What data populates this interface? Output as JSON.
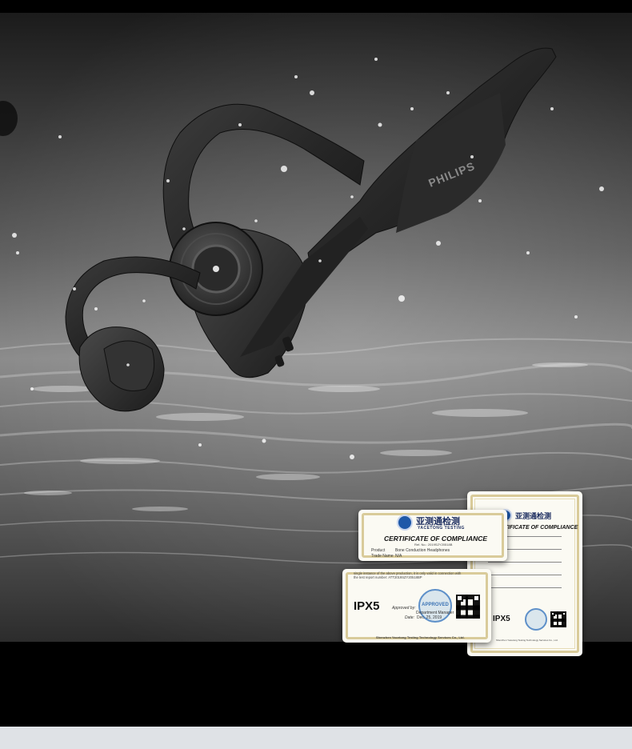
{
  "headphone": {
    "brand": "PHILIPS"
  },
  "certificates": {
    "issuer_cn": "亚测通检测",
    "issuer_en": "YACETONG TESTING",
    "front_top": {
      "title": "CERTIFICATE OF COMPLIANCE",
      "ref": "Ref. No.: 2019SZY20518B",
      "product_label": "Product",
      "product_value": "Bone Conduction Headphones",
      "trade_label": "Trade Name",
      "trade_value": "N/A"
    },
    "front_bottom": {
      "rating": "IPX5",
      "text_line1": "single instance of the above production, it is only valid in connection with",
      "text_line2": "the test report number: ATT2019SZY20518BP",
      "approved_label": "Approved by:",
      "dept_label": "Department Manager",
      "date_label": "Date:",
      "date_value": "Dec. 25, 2019",
      "stamp_text": "APPROVED",
      "company": "Shenzhen Yacetong Testing Technology Services Co., Ltd."
    },
    "back": {
      "title": "CERTIFICATE OF COMPLIANCE",
      "rating": "IPX5",
      "company": "Shenzhen Yacetong Testing Technology Services Co., Ltd."
    }
  },
  "colors": {
    "cert_gold": "#d9cb9a",
    "logo_blue": "#1e58a8",
    "footer_bar": "#dfe2e6"
  }
}
